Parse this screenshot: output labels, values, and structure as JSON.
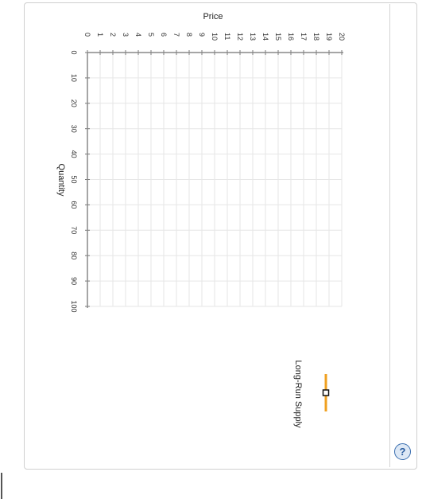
{
  "chart_data": {
    "type": "line",
    "orientation": "rotated 90 degrees clockwise",
    "price_axis": {
      "label": "Price",
      "range": [
        0,
        20
      ],
      "ticks": [
        "0",
        "1",
        "2",
        "3",
        "4",
        "5",
        "6",
        "7",
        "8",
        "9",
        "10",
        "11",
        "12",
        "13",
        "14",
        "15",
        "16",
        "17",
        "18",
        "19",
        "20"
      ]
    },
    "quantity_axis": {
      "label": "Quantity",
      "range": [
        0,
        100
      ],
      "ticks": [
        "0",
        "10",
        "20",
        "30",
        "40",
        "50",
        "60",
        "70",
        "80",
        "90",
        "100"
      ]
    },
    "grid": true,
    "series": []
  },
  "legend": {
    "tool_label": "Long-Run Supply",
    "tool_color": "#f0a020"
  },
  "help": {
    "label": "?"
  }
}
